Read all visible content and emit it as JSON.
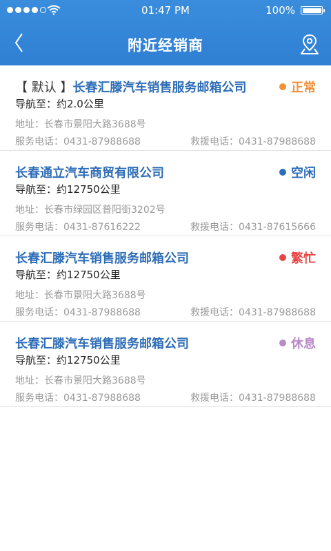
{
  "status_bar": {
    "time": "01:47 PM",
    "battery": "100%",
    "signal_icon": "signal-dots-icon",
    "wifi_icon": "wifi-icon",
    "battery_icon": "battery-icon"
  },
  "nav": {
    "title": "附近经销商",
    "back_icon": "chevron-left-icon",
    "map_icon": "map-pin-icon"
  },
  "colors": {
    "header": "#3a8ddd",
    "name": "#2e6db7",
    "normal": "#f0903a",
    "idle": "#2e6db7",
    "busy": "#e94545",
    "rest": "#b98ac8"
  },
  "dealers": [
    {
      "prefix": "【 默认 】",
      "name": "长春汇滕汽车销售服务邮箱公司",
      "status": "正常",
      "status_color": "#f0903a",
      "nav": "导航至：约2.0公里",
      "address": "地址：长春市景阳大路3688号",
      "service": "服务电话：0431-87988688",
      "rescue": "救援电话：0431-87988688"
    },
    {
      "prefix": "",
      "name": "长春通立汽车商贸有限公司",
      "status": "空闲",
      "status_color": "#2e6db7",
      "nav": "导航至：约12750公里",
      "address": "地址：长春市绿园区普阳街3202号",
      "service": "服务电话：0431-87616222",
      "rescue": "救援电话：0431-87615666"
    },
    {
      "prefix": "",
      "name": "长春汇滕汽车销售服务邮箱公司",
      "status": "繁忙",
      "status_color": "#e94545",
      "nav": "导航至：约12750公里",
      "address": "地址：长春市景阳大路3688号",
      "service": "服务电话：0431-87988688",
      "rescue": "救援电话：0431-87988688"
    },
    {
      "prefix": "",
      "name": "长春汇滕汽车销售服务邮箱公司",
      "status": "休息",
      "status_color": "#b98ac8",
      "nav": "导航至：约12750公里",
      "address": "地址：长春市景阳大路3688号",
      "service": "服务电话：0431-87988688",
      "rescue": "救援电话：0431-87988688"
    }
  ]
}
